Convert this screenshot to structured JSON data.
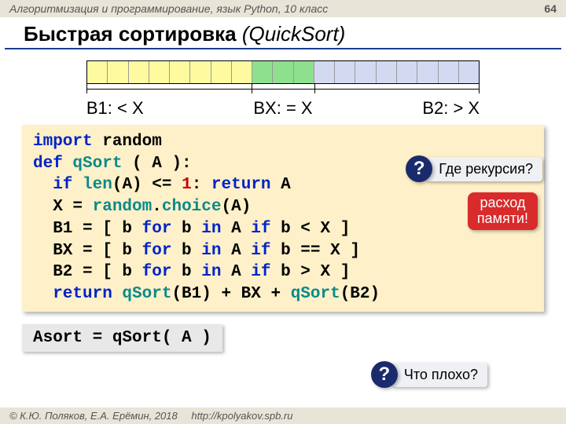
{
  "header": {
    "course": "Алгоритмизация и программирование, язык Python, 10 класс",
    "page": "64"
  },
  "title": {
    "bold": "Быстрая сортировка",
    "italic": " (QuickSort)"
  },
  "labels": {
    "b1": "B1: < X",
    "bx": "BX: = X",
    "b2": "B2: > X"
  },
  "code": {
    "l1a": "import",
    "l1b": " random",
    "l2a": "def",
    "l2b": " qSort",
    "l2c": " ( A ):",
    "l3a": "  if",
    "l3b": " len",
    "l3c": "(A) ",
    "l3d": "<=",
    "l3e": " 1",
    "l3f": ": ",
    "l3g": "return",
    "l3h": " A",
    "l4a": "  X = ",
    "l4b": "random",
    "l4c": ".",
    "l4d": "choice",
    "l4e": "(A)",
    "l5a": "  B1 = [ b ",
    "l5b": "for",
    "l5c": " b ",
    "l5d": "in",
    "l5e": " A ",
    "l5f": "if",
    "l5g": " b < X ]",
    "l6a": "  BX = [ b ",
    "l6b": "for",
    "l6c": " b ",
    "l6d": "in",
    "l6e": " A ",
    "l6f": "if",
    "l6g": " b == X ]",
    "l7a": "  B2 = [ b ",
    "l7b": "for",
    "l7c": " b ",
    "l7d": "in",
    "l7e": " A ",
    "l7f": "if",
    "l7g": " b > X ]",
    "l8a": "  return",
    "l8b": " qSort",
    "l8c": "(B1) + BX + ",
    "l8d": "qSort",
    "l8e": "(B2)"
  },
  "callouts": {
    "q": "?",
    "recursion": "Где рекурсия?",
    "memory1": "расход",
    "memory2": "памяти!",
    "bad": "Что плохо?"
  },
  "asort": "Asort = qSort( A )",
  "footer": {
    "copy": "© К.Ю. Поляков, Е.А. Ерёмин, 2018",
    "url": "http://kpolyakov.spb.ru"
  }
}
